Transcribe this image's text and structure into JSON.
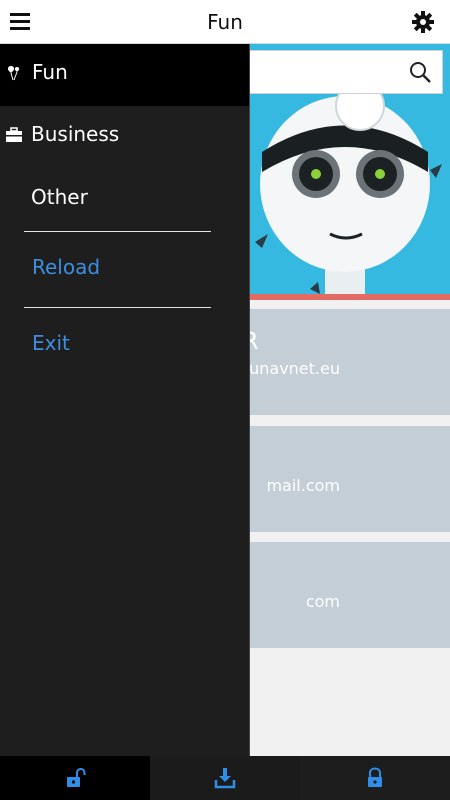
{
  "header": {
    "title": "Fun"
  },
  "drawer": {
    "items": [
      {
        "label": "Fun",
        "icon": "heart-balloon-icon"
      },
      {
        "label": "Business",
        "icon": "briefcase-icon"
      },
      {
        "label": "Other"
      },
      {
        "label": "Reload"
      },
      {
        "label": "Exit"
      }
    ]
  },
  "cards": [
    {
      "title": "R",
      "text": "unavnet.eu"
    },
    {
      "text": "mail.com"
    },
    {
      "text": "com"
    }
  ],
  "bottom_bar": {
    "tabs": [
      {
        "icon": "unlock-icon"
      },
      {
        "icon": "download-icon"
      },
      {
        "icon": "lock-icon"
      }
    ]
  },
  "colors": {
    "accent": "#3d8ee0",
    "drawer_bg": "#1e1e1e",
    "hero_bg": "#35b9e0",
    "stripe": "#e36b63",
    "card_bg": "#c4ced6"
  }
}
